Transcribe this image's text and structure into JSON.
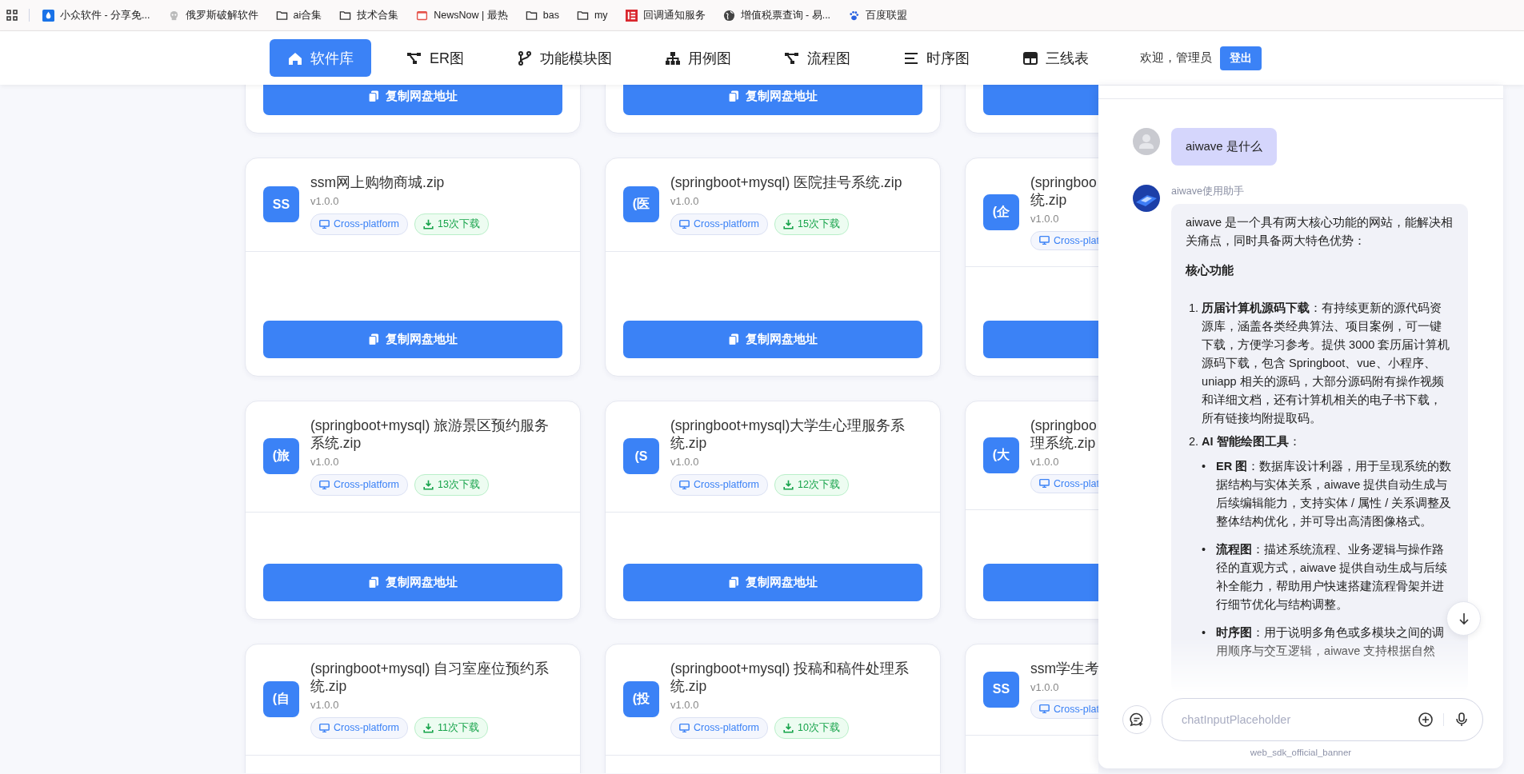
{
  "bookmarks": [
    {
      "label": "小众软件 - 分享免...",
      "kind": "site"
    },
    {
      "label": "俄罗斯破解软件",
      "kind": "site"
    },
    {
      "label": "ai合集",
      "kind": "folder"
    },
    {
      "label": "技术合集",
      "kind": "folder"
    },
    {
      "label": "NewsNow | 最热",
      "kind": "site"
    },
    {
      "label": "bas",
      "kind": "folder"
    },
    {
      "label": "my",
      "kind": "folder"
    },
    {
      "label": "回调通知服务",
      "kind": "site"
    },
    {
      "label": "增值税票查询 - 易...",
      "kind": "site"
    },
    {
      "label": "百度联盟",
      "kind": "site"
    }
  ],
  "nav": {
    "items": [
      {
        "label": "软件库",
        "selected": true
      },
      {
        "label": "ER图",
        "selected": false
      },
      {
        "label": "功能模块图",
        "selected": false
      },
      {
        "label": "用例图",
        "selected": false
      },
      {
        "label": "流程图",
        "selected": false
      },
      {
        "label": "时序图",
        "selected": false
      },
      {
        "label": "三线表",
        "selected": false
      }
    ],
    "welcome": "欢迎，管理员",
    "logout": "登出"
  },
  "cards": [
    {
      "kind": "tail",
      "button": "复制网盘地址"
    },
    {
      "kind": "tail",
      "button": "复制网盘地址"
    },
    {
      "kind": "tail"
    },
    {
      "kind": "full",
      "avatar": "SS",
      "title": "ssm网上购物商城.zip",
      "version": "v1.0.0",
      "platform": "Cross-platform",
      "downloads": "15次下载",
      "button": "复制网盘地址"
    },
    {
      "kind": "full",
      "avatar": "(医",
      "title": "(springboot+mysql) 医院挂号系统.zip",
      "version": "v1.0.0",
      "platform": "Cross-platform",
      "downloads": "15次下载",
      "button": "复制网盘地址"
    },
    {
      "kind": "full",
      "avatar": "(企",
      "title": "(springboo\n统.zip",
      "version": "v1.0.0",
      "platform": "Cross-plat"
    },
    {
      "kind": "full",
      "avatar": "(旅",
      "title": "(springboot+mysql) 旅游景区预约服务系统.zip",
      "version": "v1.0.0",
      "platform": "Cross-platform",
      "downloads": "13次下载",
      "button": "复制网盘地址"
    },
    {
      "kind": "full",
      "avatar": "(S",
      "title": "(springboot+mysql)大学生心理服务系统.zip",
      "version": "v1.0.0",
      "platform": "Cross-platform",
      "downloads": "12次下载",
      "button": "复制网盘地址"
    },
    {
      "kind": "full",
      "avatar": "(大",
      "title": "(springboo\n理系统.zip",
      "version": "v1.0.0",
      "platform": "Cross-plat"
    },
    {
      "kind": "head",
      "avatar": "(自",
      "title": "(springboot+mysql) 自习室座位预约系统.zip",
      "version": "v1.0.0",
      "platform": "Cross-platform",
      "downloads": "11次下载"
    },
    {
      "kind": "head",
      "avatar": "(投",
      "title": "(springboot+mysql) 投稿和稿件处理系统.zip",
      "version": "v1.0.0",
      "platform": "Cross-platform",
      "downloads": "10次下载"
    },
    {
      "kind": "head",
      "avatar": "SS",
      "title": "ssm学生考",
      "version": "v1.0.0",
      "platform": "Cross-plat"
    }
  ],
  "chat": {
    "user_message": "aiwave 是什么",
    "bot_name": "aiwave使用助手",
    "reply": {
      "intro": "aiwave 是一个具有两大核心功能的网站，能解决相关痛点，同时具备两大特色优势：",
      "heading": "核心功能",
      "items": [
        {
          "marker": "1.",
          "text": "**历届计算机源码下载**：有持续更新的源代码资源库，涵盖各类经典算法、项目案例，可一键下载，方便学习参考。提供 3000 套历届计算机源码下载，包含 Springboot、vue、小程序、uniapp 相关的源码，大部分源码附有操作视频和详细文档，还有计算机相关的电子书下载，所有链接均附提取码。"
        },
        {
          "marker": "2.",
          "text": "**AI 智能绘图工具**：",
          "bullets": [
            {
              "marker": "•",
              "text": "**ER 图**：数据库设计利器，用于呈现系统的数据结构与实体关系，aiwave 提供自动生成与后续编辑能力，支持实体 / 属性 / 关系调整及整体结构优化，并可导出高清图像格式。"
            },
            {
              "marker": "•",
              "text": "**流程图**：描述系统流程、业务逻辑与操作路径的直观方式，aiwave 提供自动生成与后续补全能力，帮助用户快速搭建流程骨架并进行细节优化与结构调整。"
            },
            {
              "marker": "•",
              "text": "**时序图**：用于说明多角色或多模块之间的调用顺序与交互逻辑，aiwave 支持根据自然"
            }
          ]
        }
      ]
    },
    "input": {
      "placeholder": "chatInputPlaceholder"
    },
    "footer": "web_sdk_official_banner"
  }
}
